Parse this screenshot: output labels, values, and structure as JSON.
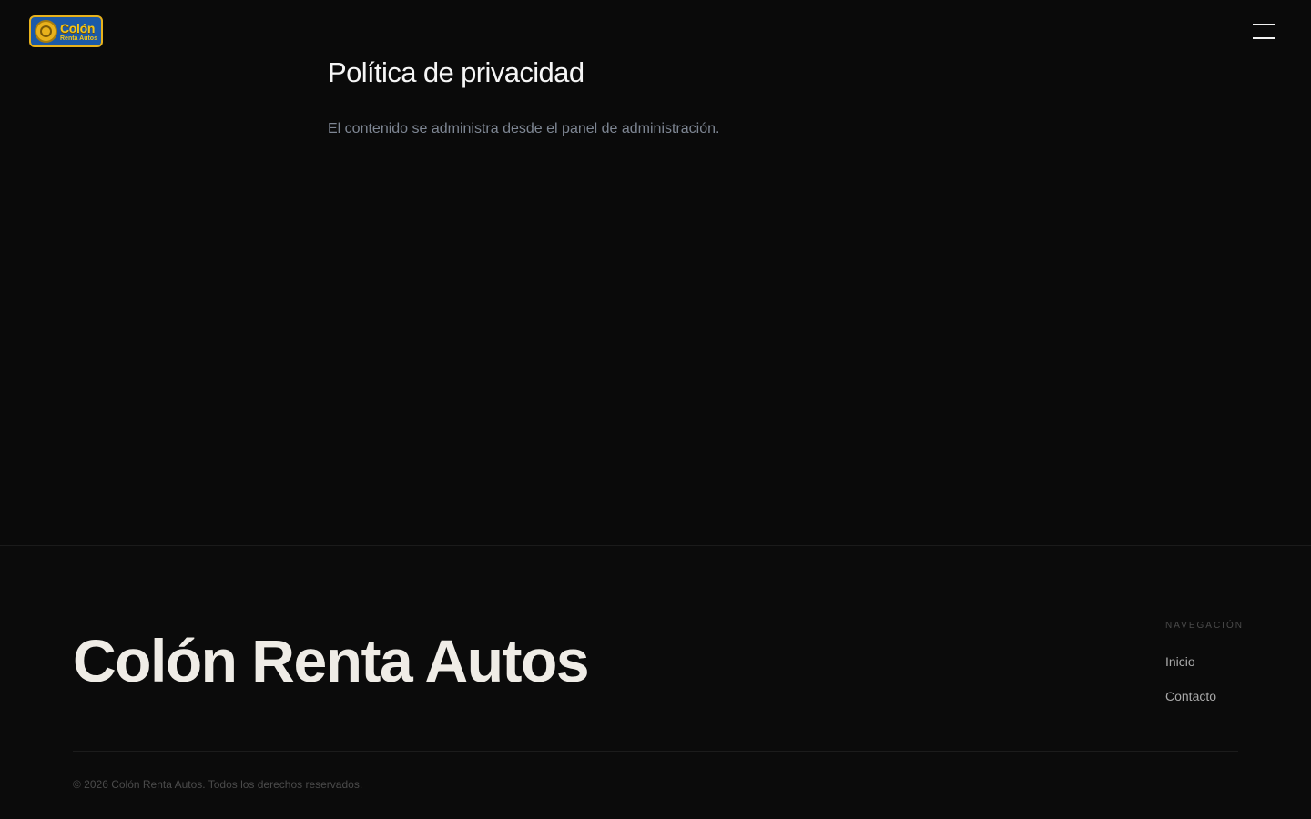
{
  "header": {
    "logo": {
      "title": "Colón",
      "subtitle": "Renta Autos"
    },
    "menu_icon": "hamburger-menu-icon"
  },
  "main": {
    "title": "Política de privacidad",
    "body": "El contenido se administra desde el panel de administración."
  },
  "footer": {
    "brand": "Colón Renta Autos",
    "nav_heading": "NAVEGACIÓN",
    "nav_links": [
      {
        "label": "Inicio"
      },
      {
        "label": "Contacto"
      }
    ],
    "copyright": "© 2026 Colón Renta Autos. Todos los derechos reservados."
  },
  "colors": {
    "background": "#0a0a0a",
    "logo_blue": "#1c5aa8",
    "logo_gold": "#f5c518",
    "text_primary": "#f5f5f5",
    "text_muted": "#7e8693"
  }
}
